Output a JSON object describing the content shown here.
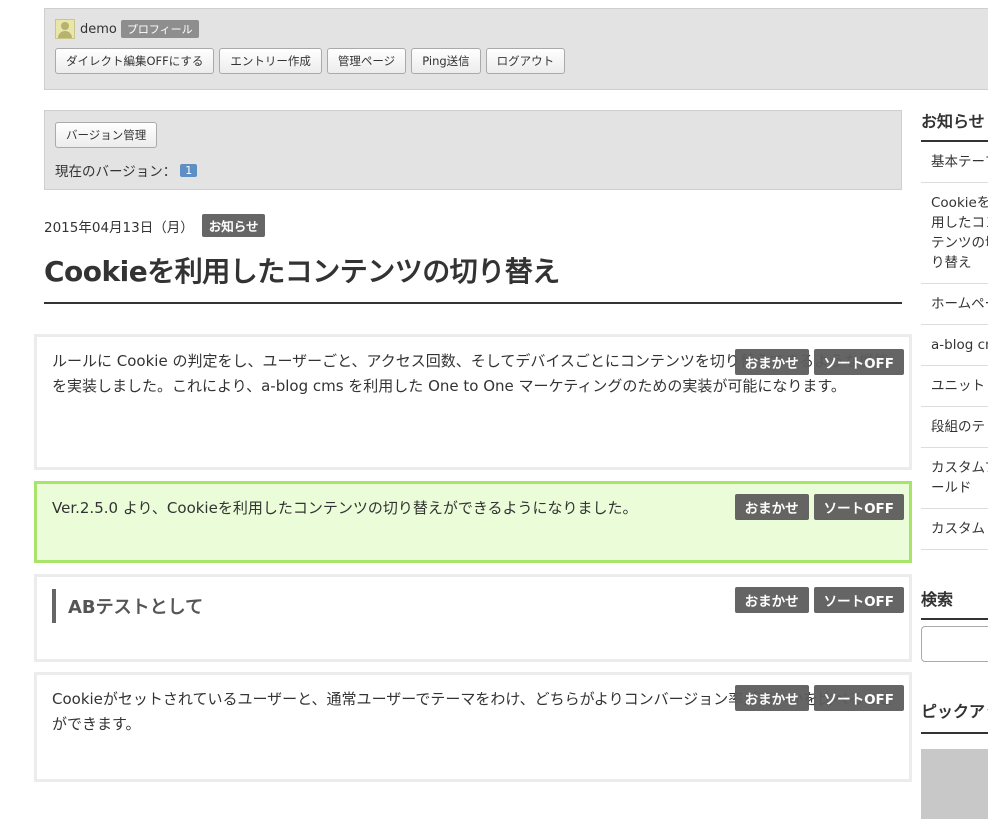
{
  "admin": {
    "username": "demo",
    "profile_badge": "プロフィール",
    "buttons": [
      "ダイレクト編集OFFにする",
      "エントリー作成",
      "管理ページ",
      "Ping送信",
      "ログアウト"
    ]
  },
  "version": {
    "manage_button": "バージョン管理",
    "current_label": "現在のバージョン：",
    "current_value": "1"
  },
  "entry": {
    "date": "2015年04月13日（月）",
    "category": "お知らせ",
    "title": "Cookieを利用したコンテンツの切り替え",
    "unit_buttons": {
      "omakase": "おまかせ",
      "sort": "ソートOFF"
    },
    "units": [
      {
        "text": "ルールに Cookie の判定をし、ユーザーごと、アクセス回数、そしてデバイスごとにコンテンツを切り替えできるような機能を実装しました。これにより、a-blog cms を利用した One to One マーケティングのための実装が可能になります。"
      },
      {
        "text": "Ver.2.5.0 より、Cookieを利用したコンテンツの切り替えができるようになりました。"
      },
      {
        "heading": "ABテストとして"
      },
      {
        "text": "Cookieがセットされているユーザーと、通常ユーザーでテーマをわけ、どちらがよりコンバージョン率が高いかを比べることができます。"
      }
    ]
  },
  "sidebar": {
    "news_title": "お知らせ",
    "news_items": [
      "基本テーマ",
      "Cookieを利用したコンテンツの切り替え",
      "ホームページ",
      "a-blog cms",
      "ユニット",
      "段組のテ",
      "カスタムフィールド",
      "カスタム"
    ],
    "search_title": "検索",
    "pickup_title": "ピックアップ"
  }
}
